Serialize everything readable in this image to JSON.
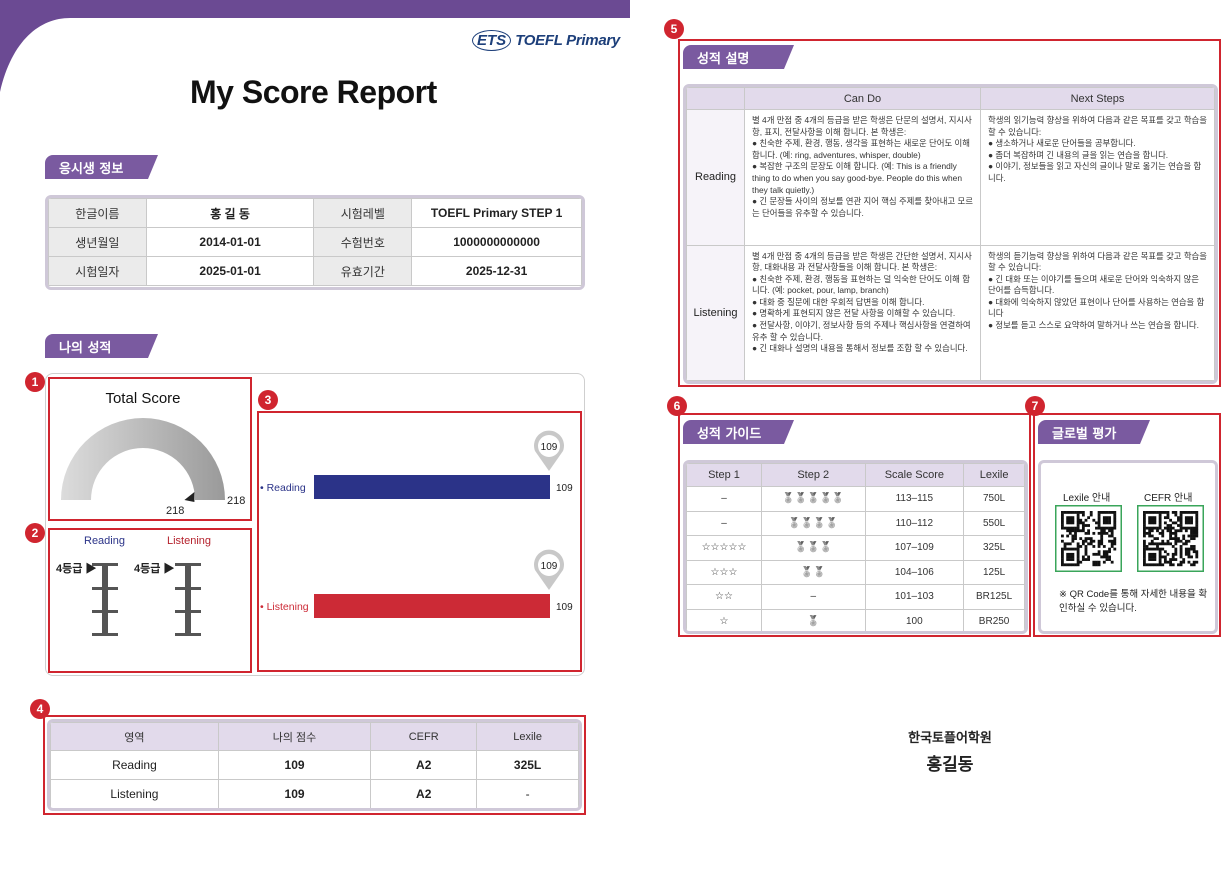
{
  "header": {
    "brand_logo": "ETS",
    "brand_product": "TOEFL Primary",
    "title": "My Score Report",
    "accent": "#6b4a93"
  },
  "badges": [
    "1",
    "2",
    "3",
    "4",
    "5",
    "6",
    "7"
  ],
  "candidate": {
    "section_title": "응시생 정보",
    "rows": [
      [
        "한글이름",
        "홍 길 동",
        "시험레벨",
        "TOEFL Primary STEP 1"
      ],
      [
        "생년월일",
        "2014-01-01",
        "수험번호",
        "1000000000000"
      ],
      [
        "시험일자",
        "2025-01-01",
        "유효기간",
        "2025-12-31"
      ]
    ]
  },
  "my_score": {
    "section_title": "나의 성적",
    "total": {
      "label": "Total Score",
      "value": 218,
      "max": 218,
      "pointer_label": "218",
      "max_label": "218"
    },
    "levels": {
      "reading_label": "Reading",
      "reading_level": "4등급",
      "listening_label": "Listening",
      "listening_level": "4등급"
    },
    "bars": [
      {
        "name": "Reading",
        "value": 109,
        "max": 109,
        "bubble": "109",
        "end_label": "109",
        "color": "#2b3388"
      },
      {
        "name": "Listening",
        "value": 109,
        "max": 109,
        "bubble": "109",
        "end_label": "109",
        "color": "#cc2a36"
      }
    ]
  },
  "summary": {
    "headers": [
      "영역",
      "나의 점수",
      "CEFR",
      "Lexile"
    ],
    "rows": [
      [
        "Reading",
        "109",
        "A2",
        "325L"
      ],
      [
        "Listening",
        "109",
        "A2",
        "-"
      ]
    ]
  },
  "explanation": {
    "section_title": "성적 설명",
    "headers": [
      "",
      "Can Do",
      "Next Steps"
    ],
    "rows": [
      {
        "label": "Reading",
        "can_do": "별 4개 만점 중 4개의 등급을 받은 학생은 단문의 설명서, 지시사항, 표지, 전달사항을 이해 합니다. 본 학생은:\n● 친숙한 주제, 환경, 행동, 생각을 표현하는 새로운 단어도 이해 합니다. (예: ring, adventures, whisper, double)\n● 복잡한 구조의 문장도 이해 합니다. (예: This is a friendly thing to do when you say good-bye. People do this when they talk quietly.)\n● 긴 문장들 사이의 정보를 연관 지어 핵심 주제를 찾아내고 모르는 단어들을 유추할 수 있습니다.",
        "next_steps": "학생의 읽기능력 향상을 위하여 다음과 같은 목표를 갖고 학습을 할 수 있습니다:\n● 생소하거나 새로운 단어들을 공부합니다.\n● 좀더 복잡하며 긴 내용의 글을 읽는 연습을 합니다.\n● 이야기, 정보들을 읽고 자신의 글이나 말로 옮기는 연습을 합니다."
      },
      {
        "label": "Listening",
        "can_do": "별 4개 만점 중 4개의 등급을 받은 학생은 간단한 설명서, 지시사항, 대화내용 과 전달사항들을 이해 합니다. 본 학생은:\n● 친숙한 주제, 환경, 행동을 표현하는 덜 익숙한 단어도 이해 합니다. (예: pocket, pour, lamp, branch)\n● 대화 중 질문에 대한 우회적 답변을 이해 합니다.\n● 명확하게 표현되지 않은 전달 사항을 이해할 수 있습니다.\n● 전달사항, 이야기, 정보사항 등의 주제나 핵심사항을 연결하여 유추 할 수 있습니다.\n● 긴 대화나 설명의 내용을 통해서 정보를 조합 할 수 있습니다.",
        "next_steps": "학생의 듣기능력 향상을 위하여 다음과 같은 목표를 갖고 학습을 할 수 있습니다:\n● 긴 대화 또는 이야기를 들으며 새로운 단어와 익숙하지 않은 단어를 습득합니다.\n● 대화에 익숙하지 않았던 표현이나 단어를 사용하는 연습을 합니다\n● 정보를 듣고 스스로 요약하여 말하거나 쓰는 연습을 합니다."
      }
    ]
  },
  "guide": {
    "section_title": "성적 가이드",
    "headers": [
      "Step 1",
      "Step 2",
      "Scale Score",
      "Lexile"
    ],
    "rows": [
      [
        "–",
        "5",
        "113–115",
        "750L"
      ],
      [
        "–",
        "4",
        "110–112",
        "550L"
      ],
      [
        "☆☆☆☆☆",
        "3",
        "107–109",
        "325L"
      ],
      [
        "☆☆☆",
        "2",
        "104–106",
        "125L"
      ],
      [
        "☆☆",
        "0",
        "101–103",
        "BR125L"
      ],
      [
        "☆",
        "1",
        "100",
        "BR250"
      ]
    ],
    "step2_dash": "–"
  },
  "global": {
    "section_title": "글로벌 평가",
    "lexile_label": "Lexile 안내",
    "cefr_label": "CEFR 안내",
    "note": "※ QR Code를 통해 자세한 내용을 확인하실 수 있습니다."
  },
  "footer": {
    "academy": "한국토플어학원",
    "name": "홍길동"
  }
}
